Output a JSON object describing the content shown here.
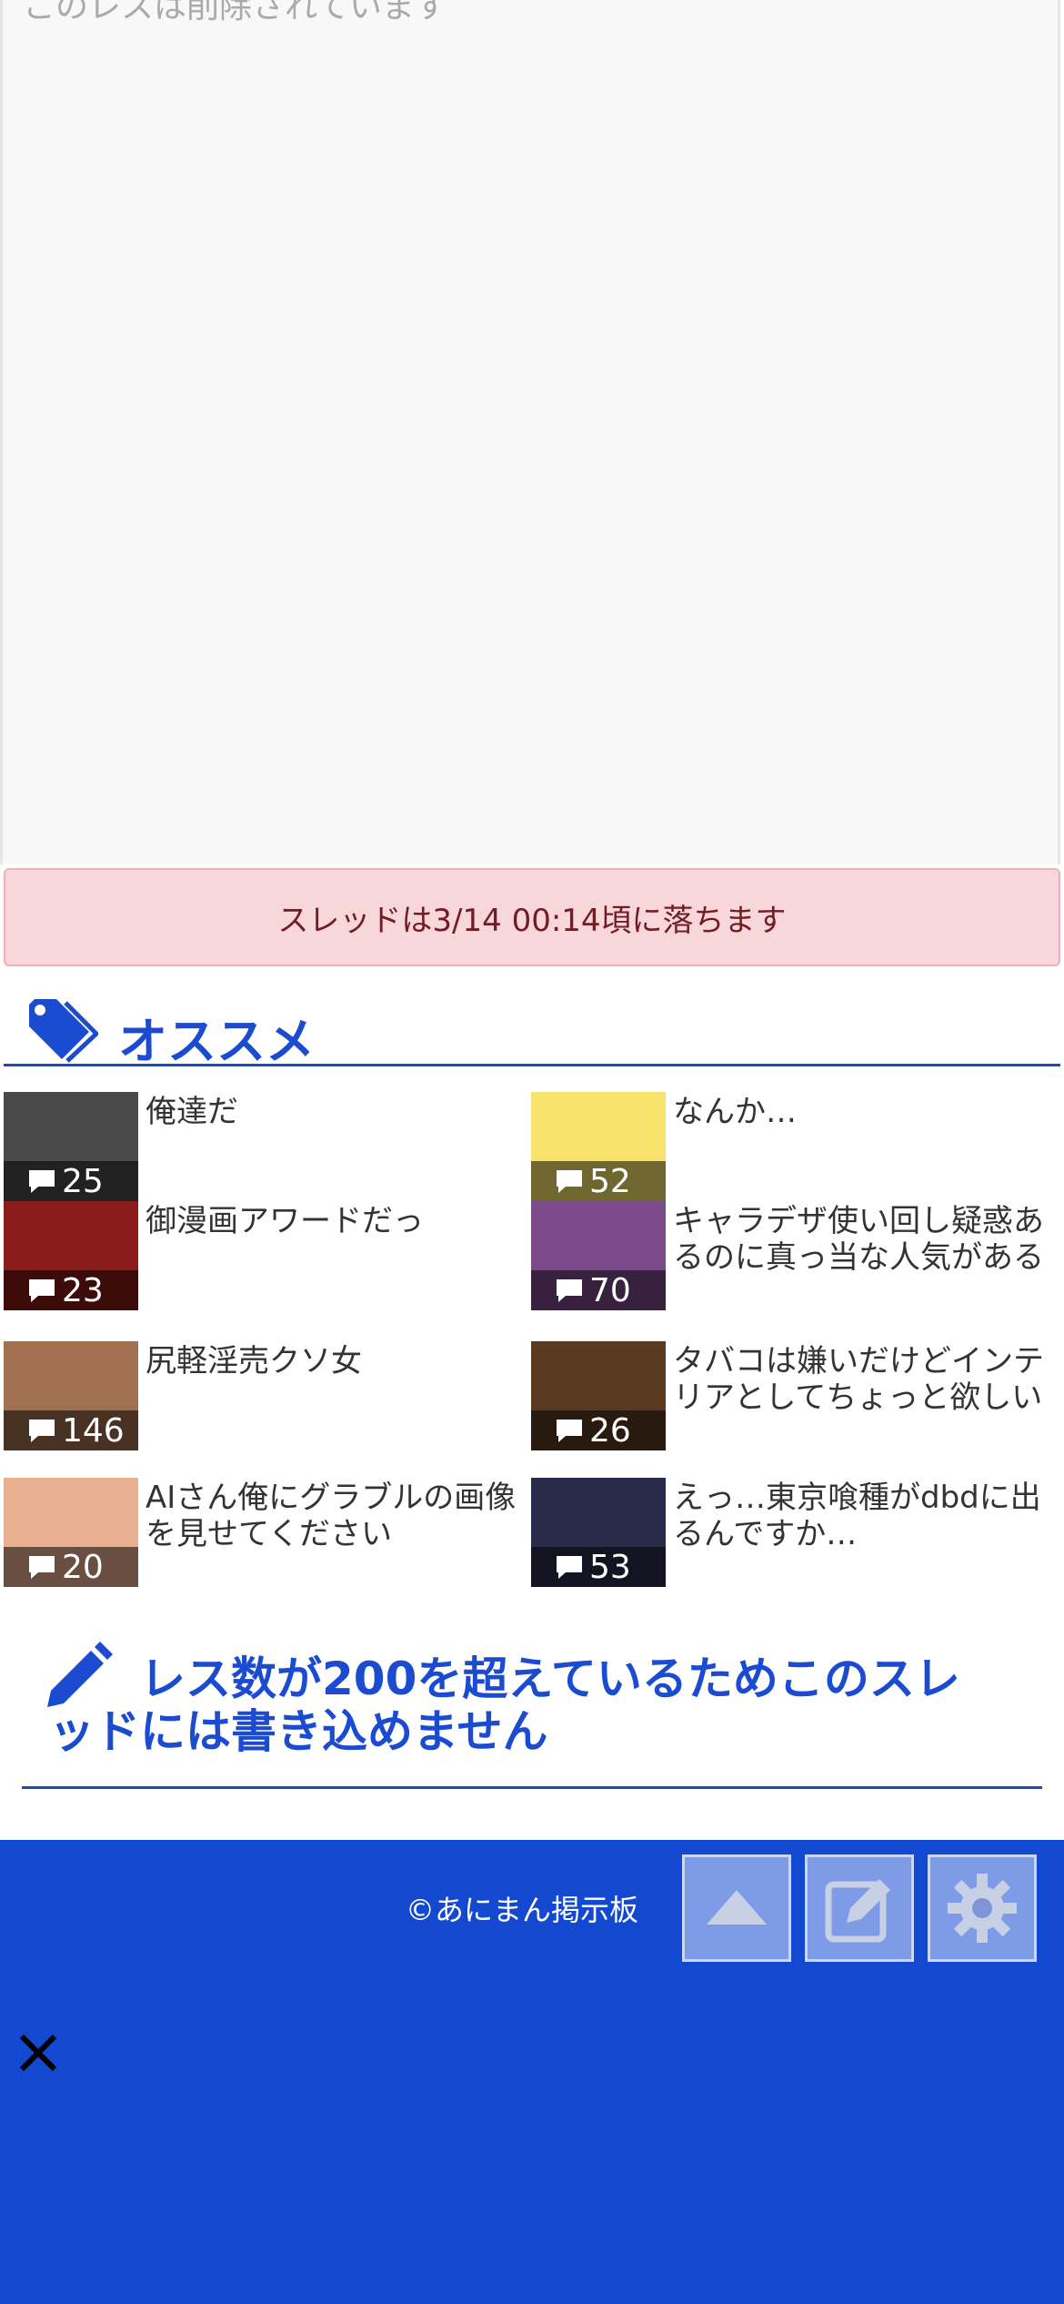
{
  "deleted": {
    "text": "このレスは削除されています"
  },
  "notice": {
    "text": "スレッドは3/14 00:14頃に落ちます"
  },
  "recommend": {
    "title": "オススメ",
    "items": [
      {
        "title": "俺達だ",
        "count": "25",
        "thumb_color": "#4a4a4a"
      },
      {
        "title": "なんか…",
        "count": "52",
        "thumb_color": "#f7e26b"
      },
      {
        "title": "御漫画アワードだっ",
        "count": "23",
        "thumb_color": "#8b1a1a"
      },
      {
        "title": "キャラデザ使い回し疑惑あるのに真っ当な人気がある",
        "count": "70",
        "thumb_color": "#7a4a8a"
      },
      {
        "title": "尻軽淫売クソ女",
        "count": "146",
        "thumb_color": "#a07050"
      },
      {
        "title": "タバコは嫌いだけどインテリアとしてちょっと欲しい",
        "count": "26",
        "thumb_color": "#5a3a20"
      },
      {
        "title": "AIさん俺にグラブルの画像を見せてください",
        "count": "20",
        "thumb_color": "#e8b090"
      },
      {
        "title": "えっ…東京喰種がdbdに出るんですか…",
        "count": "53",
        "thumb_color": "#2a2a4a"
      }
    ]
  },
  "write_notice": {
    "text": "レス数が200を超えているためこのスレッドには書き込めません"
  },
  "footer": {
    "copyright": "©あにまん掲示板",
    "buttons": [
      {
        "icon": "arrow-up-icon"
      },
      {
        "icon": "edit-icon"
      },
      {
        "icon": "gear-icon"
      }
    ]
  },
  "colors": {
    "accent": "#1a4bd0",
    "footer_bg": "#1349d1",
    "notice_bg": "#f8d7da",
    "notice_text": "#721c24"
  }
}
